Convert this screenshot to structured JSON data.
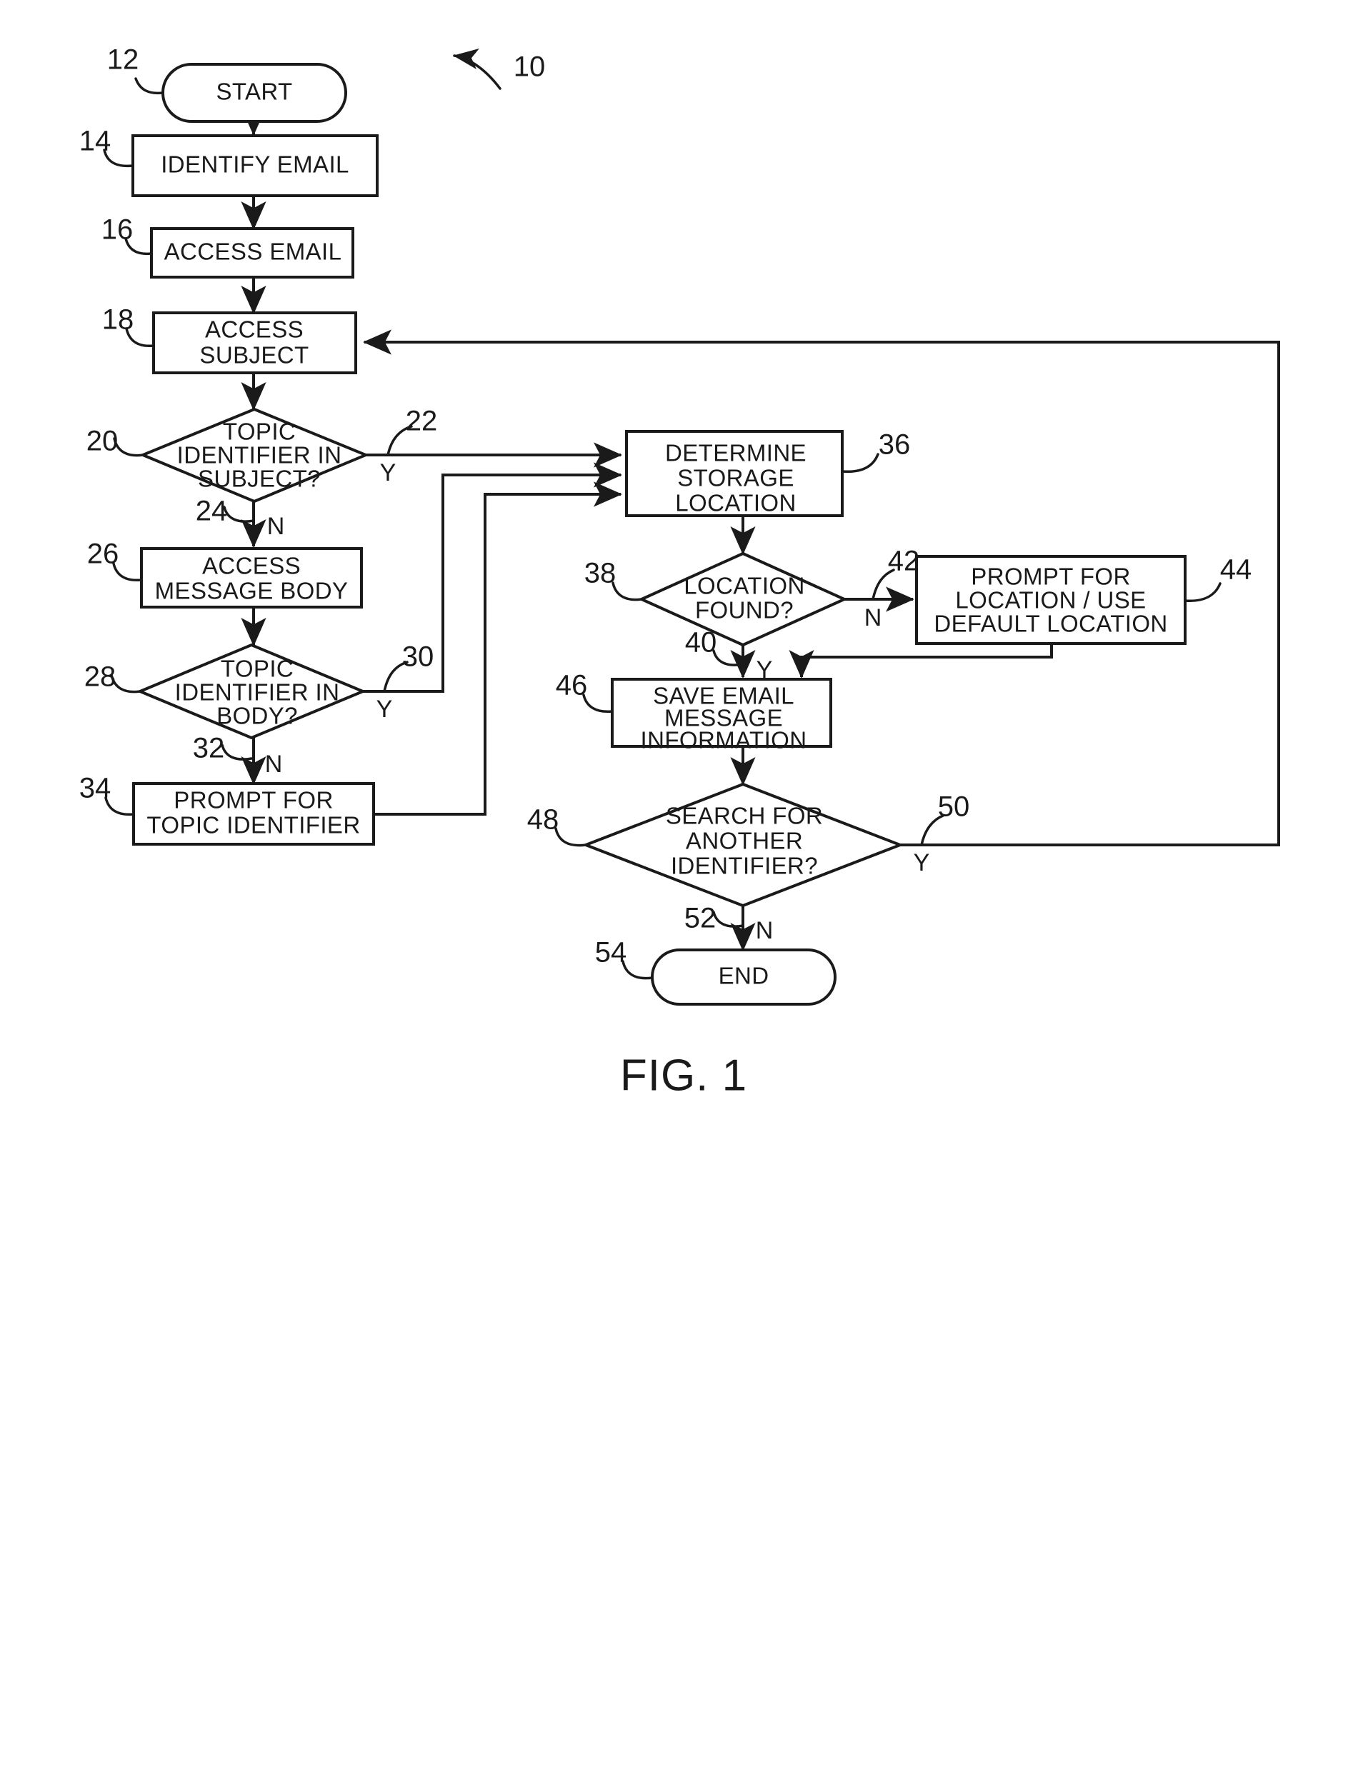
{
  "figure": {
    "caption": "FIG. 1",
    "diagram_ref": "10",
    "title_hint": "Email topic identifier filing flowchart"
  },
  "nodes": {
    "start": {
      "ref": "12",
      "label": "START",
      "shape": "terminator"
    },
    "identify_email": {
      "ref": "14",
      "label": "IDENTIFY EMAIL",
      "shape": "process"
    },
    "access_email": {
      "ref": "16",
      "label": "ACCESS EMAIL",
      "shape": "process"
    },
    "access_subject": {
      "ref": "18",
      "line1": "ACCESS",
      "line2": "SUBJECT",
      "shape": "process"
    },
    "topic_in_subject": {
      "ref": "20",
      "line1": "TOPIC",
      "line2": "IDENTIFIER IN",
      "line3": "SUBJECT?",
      "shape": "decision"
    },
    "access_message_body": {
      "ref": "26",
      "line1": "ACCESS",
      "line2": "MESSAGE BODY",
      "shape": "process"
    },
    "topic_in_body": {
      "ref": "28",
      "line1": "TOPIC",
      "line2": "IDENTIFIER IN",
      "line3": "BODY?",
      "shape": "decision"
    },
    "prompt_topic_identifier": {
      "ref": "34",
      "line1": "PROMPT FOR",
      "line2": "TOPIC IDENTIFIER",
      "shape": "process"
    },
    "determine_storage_location": {
      "ref": "36",
      "line1": "DETERMINE",
      "line2": "STORAGE",
      "line3": "LOCATION",
      "shape": "process"
    },
    "location_found": {
      "ref": "38",
      "line1": "LOCATION",
      "line2": "FOUND?",
      "shape": "decision"
    },
    "prompt_for_location": {
      "ref": "44",
      "line1": "PROMPT FOR",
      "line2": "LOCATION / USE",
      "line3": "DEFAULT LOCATION",
      "shape": "process"
    },
    "save_email_message_information": {
      "ref": "46",
      "line1": "SAVE EMAIL",
      "line2": "MESSAGE",
      "line3": "INFORMATION",
      "shape": "process"
    },
    "search_another_identifier": {
      "ref": "48",
      "line1": "SEARCH FOR",
      "line2": "ANOTHER",
      "line3": "IDENTIFIER?",
      "shape": "decision"
    },
    "end": {
      "ref": "54",
      "label": "END",
      "shape": "terminator"
    }
  },
  "branches": {
    "subject_yes": {
      "ref": "22",
      "label": "Y"
    },
    "subject_no": {
      "ref": "24",
      "label": "N"
    },
    "body_yes": {
      "ref": "30",
      "label": "Y"
    },
    "body_no": {
      "ref": "32",
      "label": "N"
    },
    "location_no": {
      "ref": "42",
      "label": "N"
    },
    "location_yes": {
      "ref": "40",
      "label": "Y"
    },
    "search_yes": {
      "ref": "50",
      "label": "Y"
    },
    "search_no": {
      "ref": "52",
      "label": "N"
    }
  },
  "colors": {
    "ink": "#1a1a1a",
    "paper": "#ffffff"
  }
}
